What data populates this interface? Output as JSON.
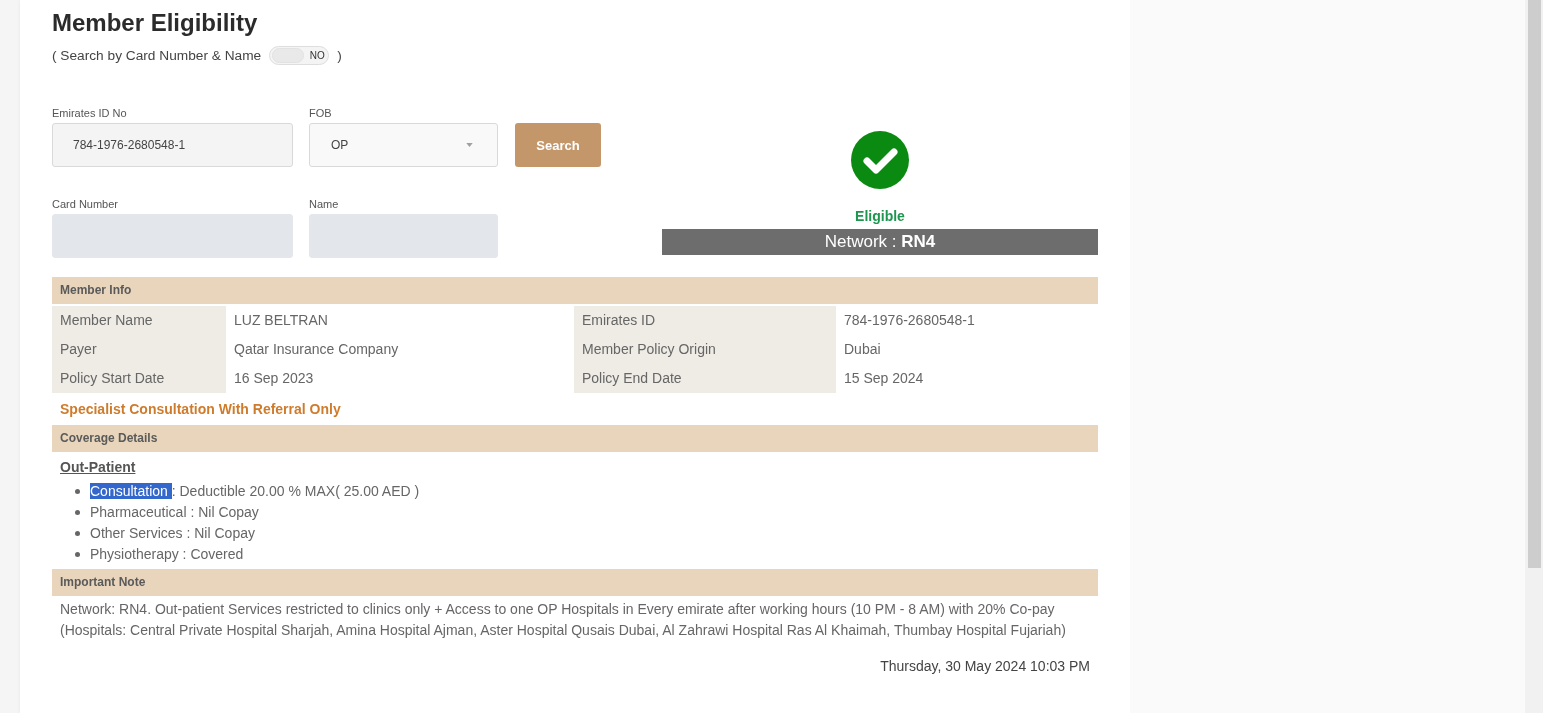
{
  "page": {
    "title": "Member Eligibility"
  },
  "search_toggle": {
    "label": "( Search by Card Number & Name",
    "state_text": "NO",
    "on": false,
    "closing": ")"
  },
  "form": {
    "rows": [
      {
        "fields": [
          {
            "kind": "input",
            "label": "Emirates ID No",
            "value": "784-1976-2680548-1",
            "disabled": false
          },
          {
            "kind": "select",
            "label": "FOB",
            "value": "OP",
            "disabled": false
          }
        ],
        "button": "Search"
      },
      {
        "fields": [
          {
            "kind": "input",
            "label": "Card Number",
            "disabled": true
          },
          {
            "kind": "input",
            "label": "Name",
            "disabled": true
          }
        ]
      }
    ]
  },
  "eligibility": {
    "eligible": true,
    "status": "Eligible",
    "network": "Network : **RN4**"
  },
  "member_info": {
    "title": "Member Info",
    "fields": [
      {
        "label": "Member Name",
        "value": "LUZ BELTRAN"
      },
      {
        "label": "Emirates ID",
        "value": "784-1976-2680548-1"
      },
      {
        "label": "Payer",
        "value": "Qatar Insurance Company"
      },
      {
        "label": "Member Policy Origin",
        "value": "Dubai"
      },
      {
        "label": "Policy Start Date",
        "value": "16 Sep 2023"
      },
      {
        "label": "Policy End Date",
        "value": "15 Sep 2024"
      }
    ]
  },
  "referral_notice": "Specialist Consultation With Referral Only",
  "coverage": {
    "title": "Coverage Details",
    "category": "Out-Patient",
    "items": [
      {
        "label": "Consultation",
        "value": ": Deductible 20.00 % MAX( 25.00 AED )",
        "highlighted": true
      },
      {
        "label": "Pharmaceutical",
        "value": ": Nil Copay",
        "highlighted": false
      },
      {
        "label": "Other Services",
        "value": ": Nil Copay",
        "highlighted": false
      },
      {
        "label": "Physiotherapy",
        "value": ": Covered",
        "highlighted": false
      }
    ]
  },
  "important_note": {
    "title": "Important Note",
    "text": "Network: RN4. Out-patient Services restricted to clinics only + Access to one OP Hospitals in Every emirate after working hours (10 PM - 8 AM) with 20% Co-pay (Hospitals: Central Private Hospital Sharjah, Amina Hospital Ajman, Aster Hospital Qusais Dubai, Al Zahrawi Hospital Ras Al Khaimah, Thumbay Hospital Fujariah)"
  },
  "timestamp": "Thursday, 30 May 2024 10:03 PM"
}
